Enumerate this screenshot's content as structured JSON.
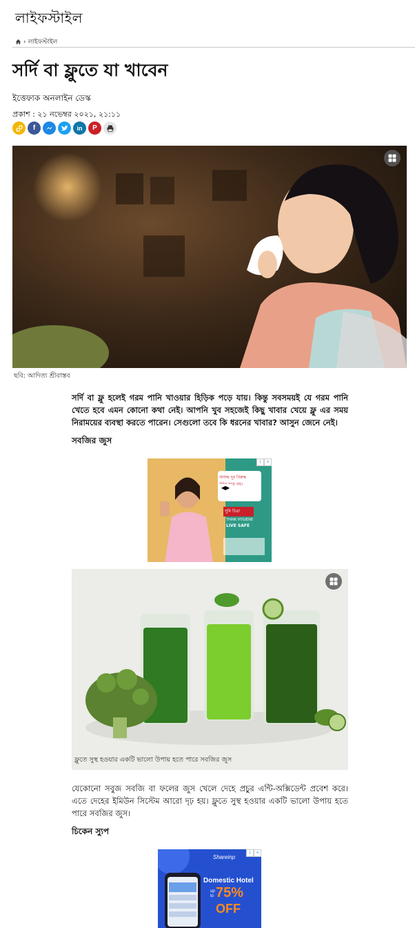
{
  "header": {
    "section_title": "লাইফস্টাইল"
  },
  "breadcrumb": {
    "home_icon": "home-icon",
    "separator": "›",
    "current": "লাইফস্টাইল"
  },
  "article": {
    "headline": "সর্দি বা ফ্লুতে যা খাবেন",
    "author": "ইত্তেফাক অনলাইন ডেস্ক",
    "published": "প্রকাশ : ২১ নভেম্বর ২০২১, ২১:১১",
    "share": [
      {
        "name": "copy-link-icon",
        "color": "#f2b705"
      },
      {
        "name": "facebook-icon",
        "color": "#3b5998",
        "glyph": "f"
      },
      {
        "name": "messenger-icon",
        "color": "#1e88e5"
      },
      {
        "name": "twitter-icon",
        "color": "#1da1f2"
      },
      {
        "name": "linkedin-icon",
        "color": "#0e76a8",
        "glyph": "in"
      },
      {
        "name": "pinterest-icon",
        "color": "#cb2027",
        "glyph": "P"
      },
      {
        "name": "print-icon",
        "color": "#e6e6e6"
      }
    ],
    "hero_caption": "ছবি: আদিত্য শ্রীবাস্তব",
    "intro": "সর্দি বা ফ্লু হলেই গরম পানি খাওয়ার হিড়িক পড়ে যায়। কিন্তু সবসময়ই যে গরম পানি খেতে হবে এমন কোনো কথা নেই। আপনি খুব সহজেই কিছু খাবার খেয়ে ফ্লু এর সময় নিরাময়ের ব্যবস্থা করতে পারেন। সেগুলো তবে কি ধরনের খাবার? আসুন জেনে নেই।",
    "subheading_1": "সবজির জুস",
    "juice_caption": "ফ্লুতে সুস্থ হওয়ার একটি ভালো উপায় হতে পারে সবজির জুস",
    "paragraph_2": "যেকোনো সবুজ সবজি বা ফলের জুস খেলে দেহে প্রচুর এন্টি-অক্সিডেন্ট প্রবেশ করে। এতে দেহের ইমিউন সিস্টেম আরো দৃঢ় হয়। ফ্লুতে সুস্থ হওয়ার একটি ভালো উপায় হতে পারে সবজির জুস।",
    "subheading_2": "চিকেন স্যুপ"
  },
  "ads": {
    "ad1": {
      "line1": "অশুদ্ধ দূর বিরুদ্ধ",
      "line2": "উঠুন ছাড় নয়।",
      "brand": "সুমি চিত্রা",
      "tag1": "THINK HYGIENE",
      "tag2": "LIVE SAFE"
    },
    "ad2": {
      "brand": "Shareinp",
      "title": "Domestic Hotel",
      "up_to": "up to",
      "percent": "75%",
      "off": "OFF"
    }
  }
}
